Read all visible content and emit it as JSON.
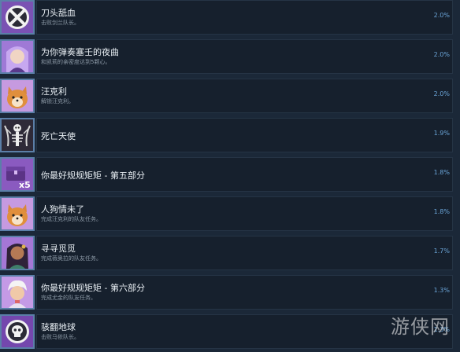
{
  "achievements": [
    {
      "title": "刀头舐血",
      "desc": "击败剑兰队长。",
      "percent": "2.0%",
      "icon": "crossed-swords-icon"
    },
    {
      "title": "为你弹奏塞壬的夜曲",
      "desc": "和凯莉的亲密度达到5颗心。",
      "percent": "2.0%",
      "icon": "purple-hair-girl-portrait-icon"
    },
    {
      "title": "汪克利",
      "desc": "解锁汪克利。",
      "percent": "2.0%",
      "icon": "shiba-dog-portrait-icon"
    },
    {
      "title": "死亡天使",
      "desc": "",
      "percent": "1.9%",
      "icon": "skeleton-wings-icon"
    },
    {
      "title": "你最好规规矩矩 - 第五部分",
      "desc": "",
      "percent": "1.8%",
      "icon": "treasure-chest-x5-icon"
    },
    {
      "title": "人狗情未了",
      "desc": "完成汪克利的队友任务。",
      "percent": "1.8%",
      "icon": "shiba-dog-portrait-icon"
    },
    {
      "title": "寻寻觅觅",
      "desc": "完成薇奥拉的队友任务。",
      "percent": "1.7%",
      "icon": "dark-hair-woman-portrait-icon"
    },
    {
      "title": "你最好规规矩矩 - 第六部分",
      "desc": "完成尤金的队友任务。",
      "percent": "1.3%",
      "icon": "white-hair-man-portrait-icon"
    },
    {
      "title": "骇翻地球",
      "desc": "击败马依队长。",
      "percent": "1.3%",
      "icon": "skull-shield-icon"
    }
  ],
  "watermark": "游侠网"
}
